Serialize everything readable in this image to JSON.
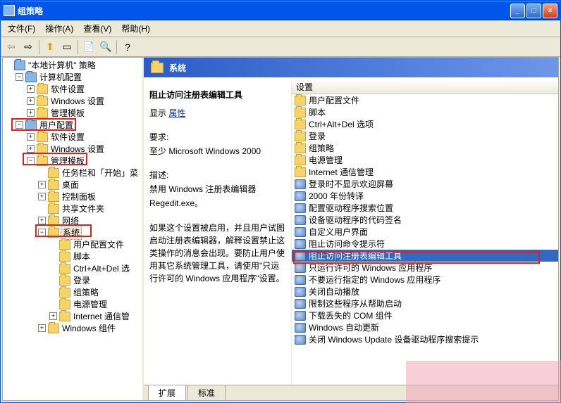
{
  "titlebar": {
    "title": "组策略"
  },
  "menu": {
    "file": "文件(F)",
    "action": "操作(A)",
    "view": "查看(V)",
    "help": "帮助(H)"
  },
  "tree": {
    "root": "\"本地计算机\" 策略",
    "computerConfig": "计算机配置",
    "softwareSettings": "软件设置",
    "windowsSettings": "Windows 设置",
    "adminTemplates": "管理模板",
    "userConfig": "用户配置",
    "taskbarStart": "任务栏和「开始」菜",
    "desktop": "桌面",
    "controlPanel": "控制面板",
    "sharedFolders": "共享文件夹",
    "network": "网络",
    "system": "系统",
    "userProfiles": "用户配置文件",
    "scripts": "脚本",
    "ctrlAltDel": "Ctrl+Alt+Del 选",
    "logon": "登录",
    "groupPolicy": "组策略",
    "powerMgmt": "电源管理",
    "internetCommMgmt": "Internet 通信管",
    "windowsComponents": "Windows 组件"
  },
  "header": {
    "title": "系统"
  },
  "detail": {
    "title": "阻止访问注册表编辑工具",
    "showLabel": "显示",
    "propLink": "属性",
    "reqLabel": "要求:",
    "reqText": "至少 Microsoft Windows 2000",
    "descLabel": "描述:",
    "descLine1": "禁用 Windows 注册表编辑器",
    "descLine2": "Regedit.exe。",
    "para": "如果这个设置被启用，并且用户试图启动注册表编辑器，解释设置禁止这类操作的消息会出现。要防止用户使用其它系统管理工具，请使用\"只运行许可的 Windows 应用程序\"设置。"
  },
  "listHeader": "设置",
  "list": {
    "folders": [
      "用户配置文件",
      "脚本",
      "Ctrl+Alt+Del 选项",
      "登录",
      "组策略",
      "电源管理",
      "Internet 通信管理"
    ],
    "settings": [
      "登录时不显示欢迎屏幕",
      "2000 年份转译",
      "配置驱动程序搜索位置",
      "设备驱动程序的代码签名",
      "自定义用户界面",
      "阻止访问命令提示符",
      "阻止访问注册表编辑工具",
      "只运行许可的 Windows 应用程序",
      "不要运行指定的 Windows 应用程序",
      "关闭自动播放",
      "限制这些程序从帮助启动",
      "下载丢失的 COM 组件",
      "Windows 自动更新",
      "关闭 Windows Update 设备驱动程序搜索提示"
    ],
    "selectedIndex": 6
  },
  "tabs": {
    "extended": "扩展",
    "standard": "标准"
  }
}
